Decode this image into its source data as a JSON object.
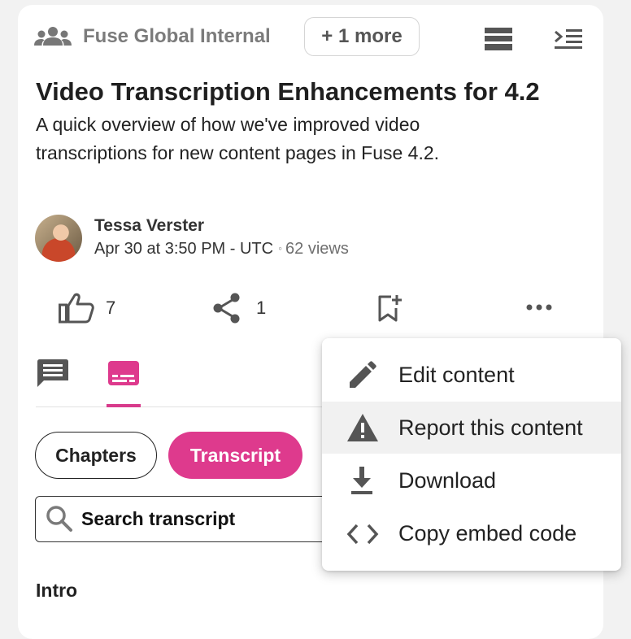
{
  "header": {
    "audience_icon": "group-icon",
    "audience_label": "Fuse Global Internal",
    "more_audiences": "+ 1 more",
    "view_toggle_icon": "stacked-bars-icon",
    "collapse_panel_icon": "indent-menu-icon"
  },
  "content": {
    "title": "Video Transcription Enhancements for 4.2",
    "description": "A quick overview of how we've improved video transcriptions for new content pages in Fuse 4.2."
  },
  "author": {
    "name": "Tessa Verster",
    "date": "Apr 30 at 3:50 PM - UTC",
    "separator": "◦",
    "views": "62 views"
  },
  "actions": {
    "like_icon": "thumbs-up-icon",
    "like_count": "7",
    "share_icon": "share-icon",
    "share_count": "1",
    "bookmark_icon": "bookmark-add-icon",
    "more_icon": "more-horizontal-icon"
  },
  "tabs": [
    {
      "icon": "comment-icon",
      "active": false
    },
    {
      "icon": "subtitles-icon",
      "active": true
    }
  ],
  "transcript": {
    "chapters_label": "Chapters",
    "transcript_label": "Transcript",
    "search_placeholder": "Search transcript",
    "section_heading": "Intro"
  },
  "menu": {
    "items": [
      {
        "label": "Edit content",
        "icon": "pencil-icon"
      },
      {
        "label": "Report this content",
        "icon": "warning-icon",
        "hovered": true
      },
      {
        "label": "Download",
        "icon": "download-icon"
      },
      {
        "label": "Copy embed code",
        "icon": "code-icon"
      }
    ]
  },
  "colors": {
    "accent": "#de3a8d",
    "text": "#1f1f1f",
    "muted": "#7b7b7b",
    "background": "#f2f2f2"
  }
}
